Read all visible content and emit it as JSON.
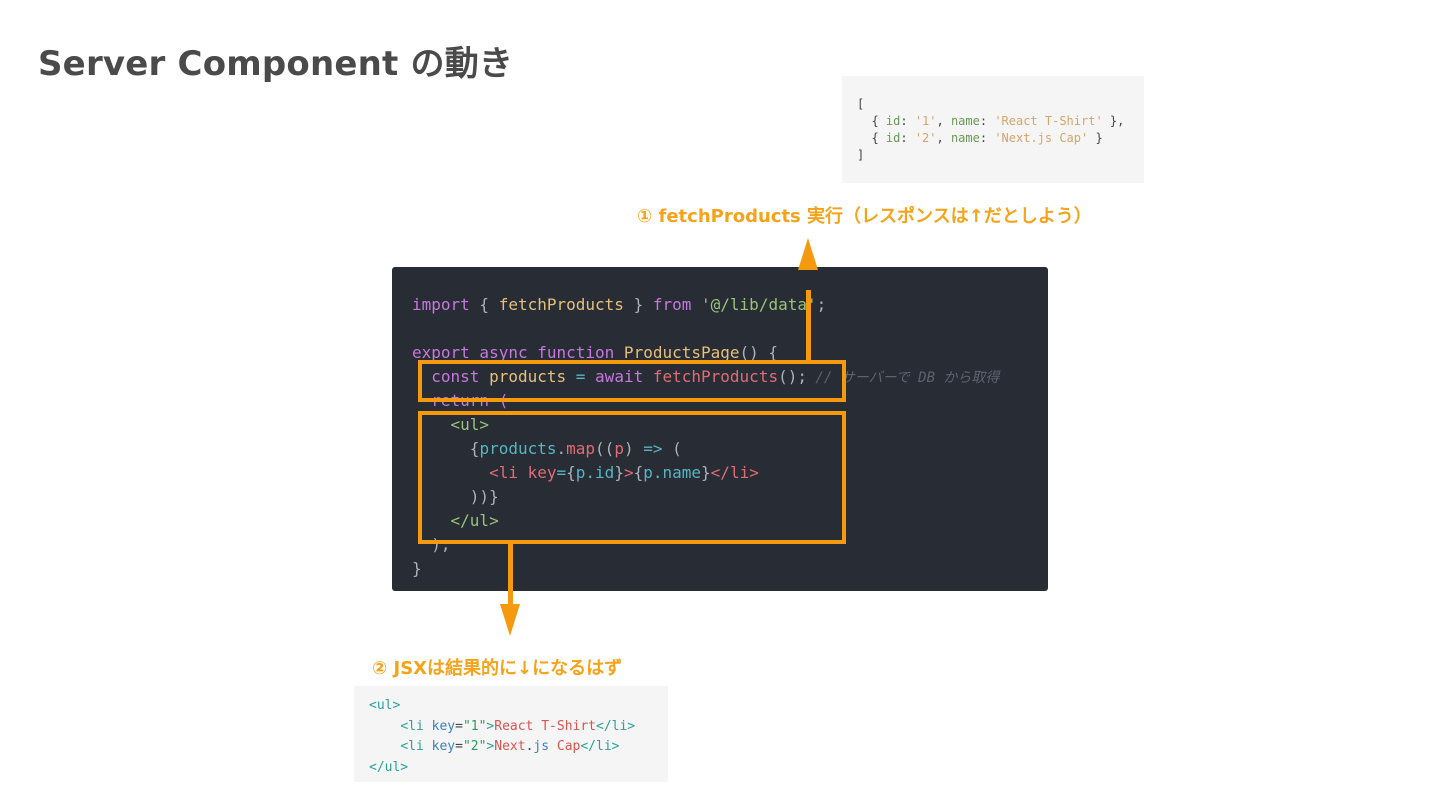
{
  "page": {
    "title": "Server Component の動き"
  },
  "response": {
    "line1": "[",
    "line2_a": "  { ",
    "line2_id_key": "id",
    "line2_colon1": ": ",
    "line2_id_val": "'1'",
    "line2_comma": ", ",
    "line2_name_key": "name",
    "line2_colon2": ": ",
    "line2_name_val": "'React T-Shirt'",
    "line2_end": " },",
    "line3_a": "  { ",
    "line3_id_key": "id",
    "line3_colon1": ": ",
    "line3_id_val": "'2'",
    "line3_comma": ", ",
    "line3_name_key": "name",
    "line3_colon2": ": ",
    "line3_name_val": "'Next.js Cap'",
    "line3_end": " }",
    "line4": "]"
  },
  "annotations": {
    "step1": "① fetchProducts 実行（レスポンスは↑だとしよう）",
    "step2": "② JSXは結果的に↓になるはず"
  },
  "code": {
    "l1_import": "import",
    "l1_open": " { ",
    "l1_fn": "fetchProducts",
    "l1_close": " } ",
    "l1_from": "from",
    "l1_sp": " ",
    "l1_path": "'@/lib/data'",
    "l1_semi": ";",
    "l3_export": "export",
    "l3_async": " async",
    "l3_function": " function",
    "l3_name": " ProductsPage",
    "l3_rest": "() {",
    "l4_indent": "  ",
    "l4_const": "const",
    "l4_var": " products",
    "l4_eq": " = ",
    "l4_await": "await",
    "l4_call": " fetchProducts",
    "l4_paren": "();",
    "l4_comment": " // サーバーで DB から取得",
    "l5_return": "  return (",
    "l6_open": "    <ul>",
    "l7_a": "      {",
    "l7_var": "products",
    "l7_dot": ".",
    "l7_map": "map",
    "l7_b": "((",
    "l7_p": "p",
    "l7_c": ") ",
    "l7_arrow": "=>",
    "l7_d": " (",
    "l8_indent": "        ",
    "l8_tag": "<li",
    "l8_attr": " key",
    "l8_eq": "=",
    "l8_brace1": "{",
    "l8_pid": "p.id",
    "l8_brace2": "}",
    "l8_gt": ">",
    "l8_brace3": "{",
    "l8_pname": "p.name",
    "l8_brace4": "}",
    "l8_close": "</li>",
    "l9": "      ))}",
    "l10_close": "    </ul>",
    "l11": "  );",
    "l12": "}"
  },
  "result": {
    "l1": "<ul>",
    "l2_indent": "    ",
    "l2_tag": "<li ",
    "l2_attr": "key",
    "l2_eq": "=",
    "l2_val": "\"1\"",
    "l2_gt": ">",
    "l2_text": "React T-Shirt",
    "l2_close": "</li>",
    "l3_indent": "    ",
    "l3_tag": "<li ",
    "l3_attr": "key",
    "l3_eq": "=",
    "l3_val": "\"2\"",
    "l3_gt": ">",
    "l3_text1": "Next",
    "l3_dot": ".",
    "l3_text2": "js",
    "l3_text3": " Cap",
    "l3_close": "</li>",
    "l4": "</ul>"
  }
}
